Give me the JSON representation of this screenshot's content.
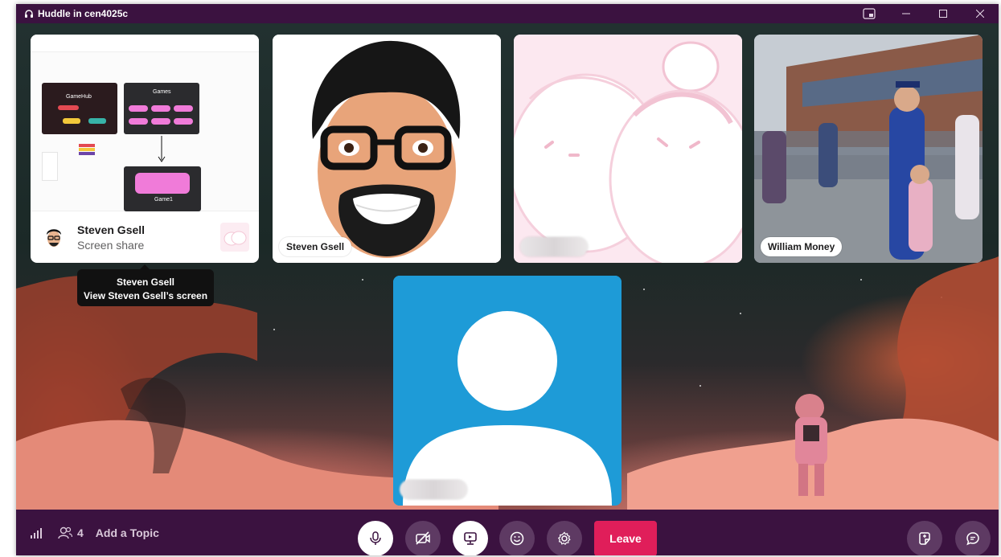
{
  "window": {
    "title": "Huddle in cen4025c",
    "controls": [
      "picture-in-picture",
      "minimize",
      "maximize",
      "close"
    ]
  },
  "screen_share": {
    "presenter": "Steven Gsell",
    "subtitle": "Screen share",
    "preview": {
      "tab1": "GameHub",
      "tab2": "Games",
      "tab3": "Game1"
    }
  },
  "tooltip": {
    "title": "Steven Gsell",
    "body": "View Steven Gsell’s screen"
  },
  "participants": [
    {
      "name": "Steven Gsell",
      "kind": "cartoon-avatar"
    },
    {
      "name": "",
      "kind": "blurred-name",
      "image": "pink-bunnies"
    },
    {
      "name": "William Money",
      "kind": "photo"
    },
    {
      "name": "",
      "kind": "blurred-name",
      "image": "default-avatar"
    }
  ],
  "toolbar": {
    "participant_count": "4",
    "add_topic": "Add a Topic",
    "leave_label": "Leave",
    "colors": {
      "leave": "#e01e5a",
      "bar": "#3b1240"
    }
  }
}
